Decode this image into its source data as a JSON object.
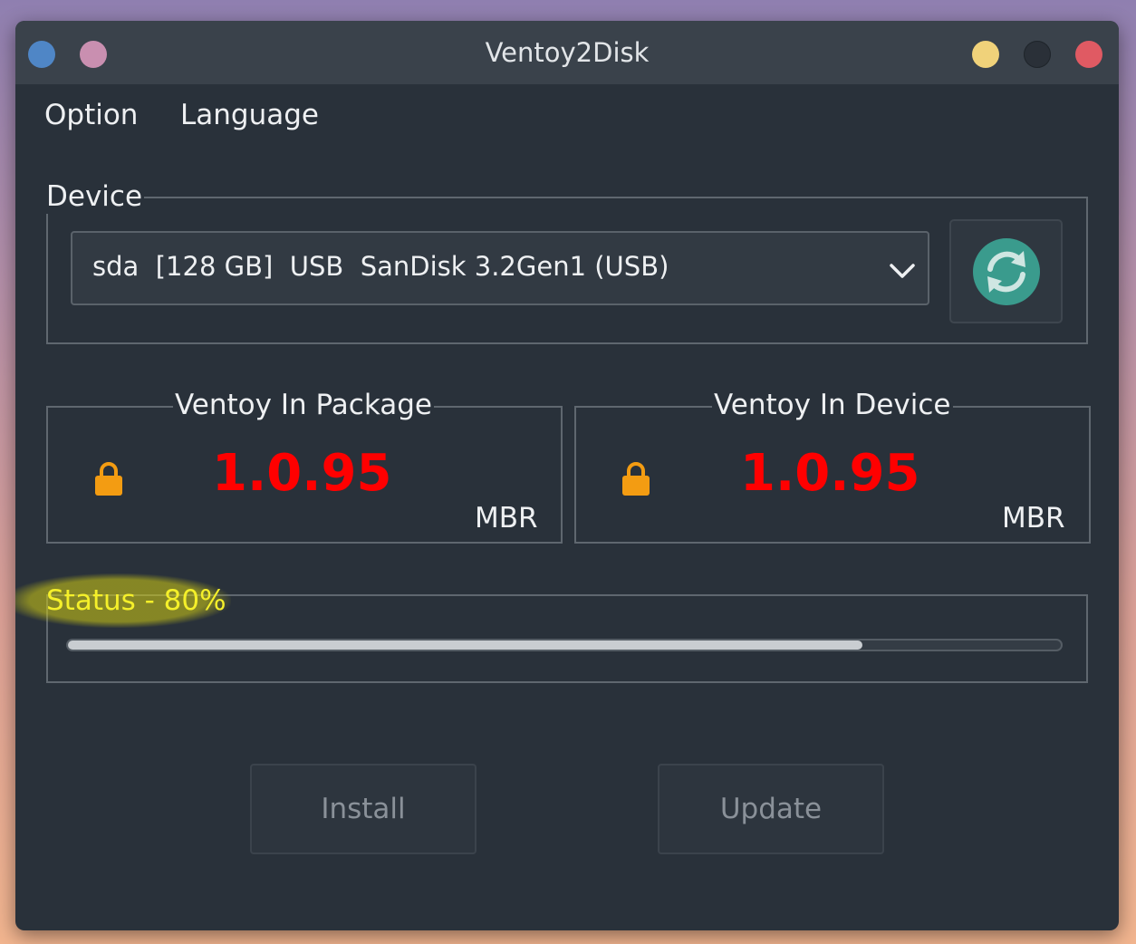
{
  "window": {
    "title": "Ventoy2Disk",
    "title_buttons": {
      "left": [
        "blue-dot",
        "pink-dot"
      ],
      "right": [
        "minimize",
        "maximize",
        "close"
      ],
      "colors": {
        "blue": "#4f86c6",
        "pink": "#c98fb0",
        "yellow": "#f0d27a",
        "dark": "#2a3038",
        "red": "#e05a63"
      }
    }
  },
  "menu": {
    "items": [
      "Option",
      "Language"
    ]
  },
  "device": {
    "label": "Device",
    "selected": "sda  [128 GB]  USB  SanDisk 3.2Gen1 (USB)",
    "refresh_icon": "refresh-icon"
  },
  "package": {
    "label": "Ventoy In Package",
    "version": "1.0.95",
    "partition_style": "MBR"
  },
  "installed": {
    "label": "Ventoy In Device",
    "version": "1.0.95",
    "partition_style": "MBR"
  },
  "status": {
    "label": "Status - 80%",
    "progress": 0.8
  },
  "buttons": {
    "install": "Install",
    "update": "Update"
  },
  "colors": {
    "version": "#ff0000",
    "status_highlight": "#f5f02a",
    "lock": "#f39c12",
    "refresh": "#3a9b8d"
  }
}
